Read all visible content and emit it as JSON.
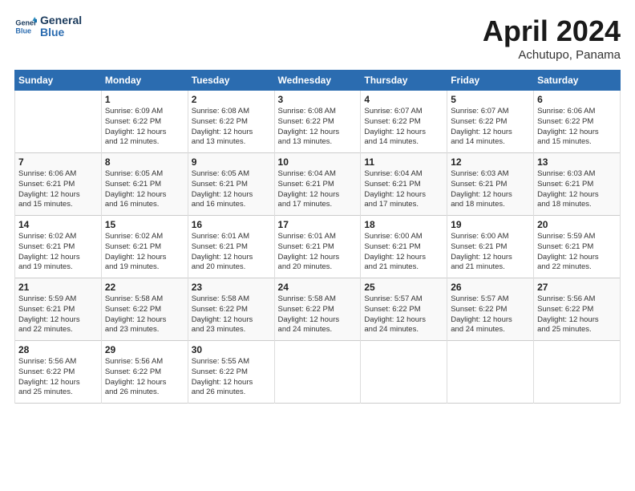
{
  "logo": {
    "line1": "General",
    "line2": "Blue"
  },
  "title": "April 2024",
  "subtitle": "Achutupo, Panama",
  "days_header": [
    "Sunday",
    "Monday",
    "Tuesday",
    "Wednesday",
    "Thursday",
    "Friday",
    "Saturday"
  ],
  "weeks": [
    [
      {
        "day": "",
        "info": ""
      },
      {
        "day": "1",
        "info": "Sunrise: 6:09 AM\nSunset: 6:22 PM\nDaylight: 12 hours\nand 12 minutes."
      },
      {
        "day": "2",
        "info": "Sunrise: 6:08 AM\nSunset: 6:22 PM\nDaylight: 12 hours\nand 13 minutes."
      },
      {
        "day": "3",
        "info": "Sunrise: 6:08 AM\nSunset: 6:22 PM\nDaylight: 12 hours\nand 13 minutes."
      },
      {
        "day": "4",
        "info": "Sunrise: 6:07 AM\nSunset: 6:22 PM\nDaylight: 12 hours\nand 14 minutes."
      },
      {
        "day": "5",
        "info": "Sunrise: 6:07 AM\nSunset: 6:22 PM\nDaylight: 12 hours\nand 14 minutes."
      },
      {
        "day": "6",
        "info": "Sunrise: 6:06 AM\nSunset: 6:22 PM\nDaylight: 12 hours\nand 15 minutes."
      }
    ],
    [
      {
        "day": "7",
        "info": "Sunrise: 6:06 AM\nSunset: 6:21 PM\nDaylight: 12 hours\nand 15 minutes."
      },
      {
        "day": "8",
        "info": "Sunrise: 6:05 AM\nSunset: 6:21 PM\nDaylight: 12 hours\nand 16 minutes."
      },
      {
        "day": "9",
        "info": "Sunrise: 6:05 AM\nSunset: 6:21 PM\nDaylight: 12 hours\nand 16 minutes."
      },
      {
        "day": "10",
        "info": "Sunrise: 6:04 AM\nSunset: 6:21 PM\nDaylight: 12 hours\nand 17 minutes."
      },
      {
        "day": "11",
        "info": "Sunrise: 6:04 AM\nSunset: 6:21 PM\nDaylight: 12 hours\nand 17 minutes."
      },
      {
        "day": "12",
        "info": "Sunrise: 6:03 AM\nSunset: 6:21 PM\nDaylight: 12 hours\nand 18 minutes."
      },
      {
        "day": "13",
        "info": "Sunrise: 6:03 AM\nSunset: 6:21 PM\nDaylight: 12 hours\nand 18 minutes."
      }
    ],
    [
      {
        "day": "14",
        "info": "Sunrise: 6:02 AM\nSunset: 6:21 PM\nDaylight: 12 hours\nand 19 minutes."
      },
      {
        "day": "15",
        "info": "Sunrise: 6:02 AM\nSunset: 6:21 PM\nDaylight: 12 hours\nand 19 minutes."
      },
      {
        "day": "16",
        "info": "Sunrise: 6:01 AM\nSunset: 6:21 PM\nDaylight: 12 hours\nand 20 minutes."
      },
      {
        "day": "17",
        "info": "Sunrise: 6:01 AM\nSunset: 6:21 PM\nDaylight: 12 hours\nand 20 minutes."
      },
      {
        "day": "18",
        "info": "Sunrise: 6:00 AM\nSunset: 6:21 PM\nDaylight: 12 hours\nand 21 minutes."
      },
      {
        "day": "19",
        "info": "Sunrise: 6:00 AM\nSunset: 6:21 PM\nDaylight: 12 hours\nand 21 minutes."
      },
      {
        "day": "20",
        "info": "Sunrise: 5:59 AM\nSunset: 6:21 PM\nDaylight: 12 hours\nand 22 minutes."
      }
    ],
    [
      {
        "day": "21",
        "info": "Sunrise: 5:59 AM\nSunset: 6:21 PM\nDaylight: 12 hours\nand 22 minutes."
      },
      {
        "day": "22",
        "info": "Sunrise: 5:58 AM\nSunset: 6:22 PM\nDaylight: 12 hours\nand 23 minutes."
      },
      {
        "day": "23",
        "info": "Sunrise: 5:58 AM\nSunset: 6:22 PM\nDaylight: 12 hours\nand 23 minutes."
      },
      {
        "day": "24",
        "info": "Sunrise: 5:58 AM\nSunset: 6:22 PM\nDaylight: 12 hours\nand 24 minutes."
      },
      {
        "day": "25",
        "info": "Sunrise: 5:57 AM\nSunset: 6:22 PM\nDaylight: 12 hours\nand 24 minutes."
      },
      {
        "day": "26",
        "info": "Sunrise: 5:57 AM\nSunset: 6:22 PM\nDaylight: 12 hours\nand 24 minutes."
      },
      {
        "day": "27",
        "info": "Sunrise: 5:56 AM\nSunset: 6:22 PM\nDaylight: 12 hours\nand 25 minutes."
      }
    ],
    [
      {
        "day": "28",
        "info": "Sunrise: 5:56 AM\nSunset: 6:22 PM\nDaylight: 12 hours\nand 25 minutes."
      },
      {
        "day": "29",
        "info": "Sunrise: 5:56 AM\nSunset: 6:22 PM\nDaylight: 12 hours\nand 26 minutes."
      },
      {
        "day": "30",
        "info": "Sunrise: 5:55 AM\nSunset: 6:22 PM\nDaylight: 12 hours\nand 26 minutes."
      },
      {
        "day": "",
        "info": ""
      },
      {
        "day": "",
        "info": ""
      },
      {
        "day": "",
        "info": ""
      },
      {
        "day": "",
        "info": ""
      }
    ]
  ]
}
